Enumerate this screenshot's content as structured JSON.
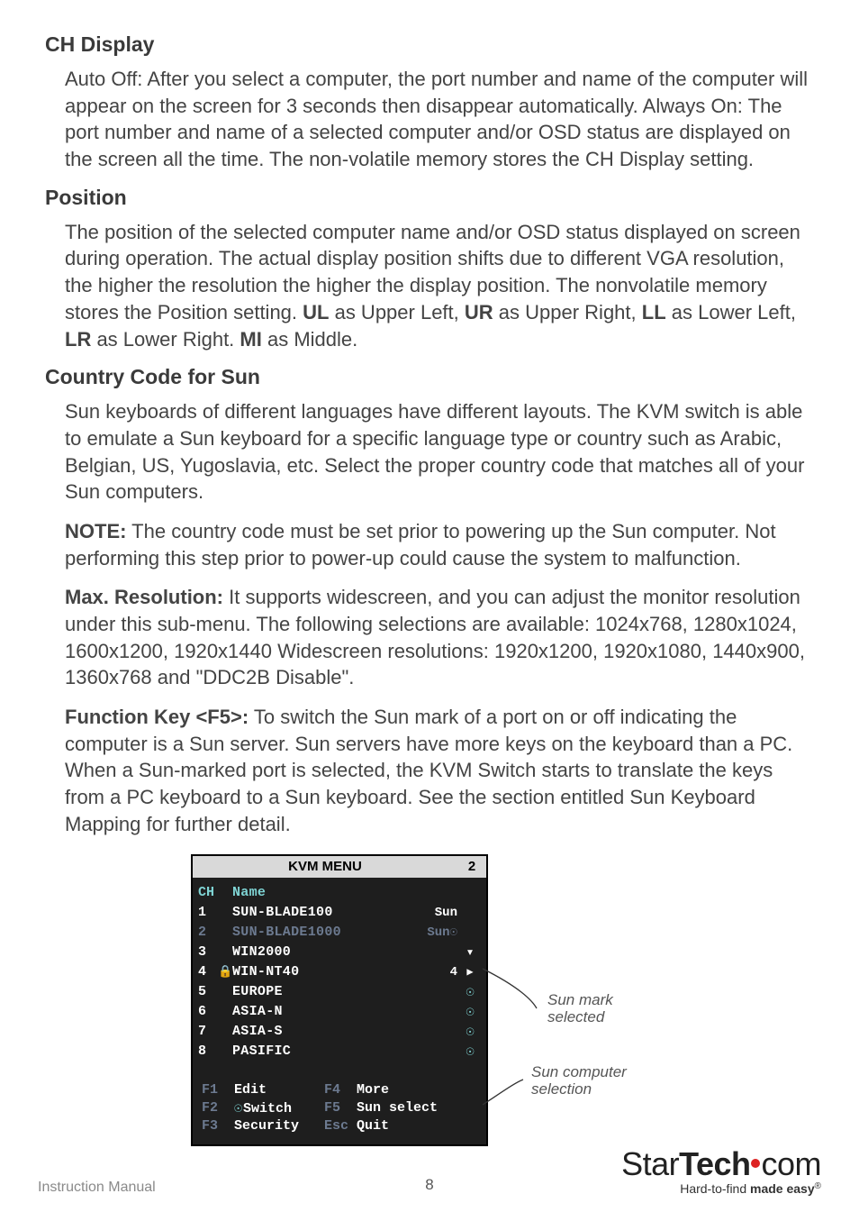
{
  "sections": {
    "ch_display": {
      "head": "CH Display",
      "body": "Auto Off: After you select a computer, the port number and name of the computer will appear on the screen for 3 seconds then disappear automatically. Always On: The port number and name of a selected computer and/or OSD status are displayed on the screen all the time. The non-volatile memory stores the CH Display setting."
    },
    "position": {
      "head": "Position",
      "body_pre": "The position of the selected computer name and/or OSD status displayed on screen during operation. The actual display position shifts due to different VGA resolution, the higher the resolution the higher the display position. The nonvolatile memory stores the Position setting.  ",
      "ul": "UL",
      "ul_txt": " as Upper Left, ",
      "ur": "UR",
      "ur_txt": " as Upper Right, ",
      "ll": "LL",
      "ll_txt": " as Lower Left, ",
      "lr": "LR",
      "lr_txt": " as Lower Right. ",
      "mi": "MI",
      "mi_txt": " as Middle."
    },
    "country": {
      "head": "Country Code for Sun",
      "body": "Sun keyboards of different languages have different layouts. The KVM switch is able to emulate a Sun keyboard for a specific language type or country such as Arabic, Belgian, US, Yugoslavia, etc. Select the proper country code that matches all of your Sun computers.",
      "note_b": "NOTE:",
      "note": " The country code must be set prior to powering up the Sun computer. Not performing this step prior to power-up could cause the system to malfunction."
    },
    "maxres": {
      "b": "Max. Resolution:",
      "body": " It supports widescreen, and you can adjust the monitor resolution under this sub-menu. The following selections are available: 1024x768, 1280x1024, 1600x1200, 1920x1440 Widescreen resolutions: 1920x1200, 1920x1080, 1440x900, 1360x768 and \"DDC2B Disable\"."
    },
    "f5": {
      "b": "Function Key <F5>:",
      "body": " To switch the Sun mark of a port on or off indicating the computer is a Sun server. Sun servers have more keys on the keyboard than a PC. When a Sun-marked port is selected, the KVM Switch starts to translate the keys from a PC keyboard to a Sun keyboard. See the section entitled Sun Keyboard Mapping for further detail."
    }
  },
  "kvm": {
    "title": "KVM MENU",
    "title_num": "2",
    "head_ch": "CH",
    "head_name": "Name",
    "rows": [
      {
        "ch": "1",
        "lock": "",
        "name": "SUN-BLADE100",
        "tag": "Sun",
        "mark": "",
        "dim": false
      },
      {
        "ch": "2",
        "lock": "",
        "name": "SUN-BLADE1000",
        "tag": "Sun☉",
        "mark": "",
        "dim": true
      },
      {
        "ch": "3",
        "lock": "",
        "name": "WIN2000",
        "tag": "",
        "mark": "▾",
        "dim": false
      },
      {
        "ch": "4",
        "lock": "🔒",
        "name": "WIN-NT40",
        "tag": "4",
        "mark": "▶",
        "dim": false
      },
      {
        "ch": "5",
        "lock": "",
        "name": "EUROPE",
        "tag": "",
        "mark": "☉",
        "dim": false
      },
      {
        "ch": "6",
        "lock": "",
        "name": "ASIA-N",
        "tag": "",
        "mark": "☉",
        "dim": false
      },
      {
        "ch": "7",
        "lock": "",
        "name": "ASIA-S",
        "tag": "",
        "mark": "☉",
        "dim": false
      },
      {
        "ch": "8",
        "lock": "",
        "name": "PASIFIC",
        "tag": "",
        "mark": "☉",
        "dim": false
      }
    ],
    "bottom": {
      "f1": "F1",
      "f1l": "Edit",
      "f2": "F2",
      "f2l": "Switch",
      "f3": "F3",
      "f3l": "Security",
      "f4": "F4",
      "f4l": "More",
      "f5": "F5",
      "f5l": "Sun select",
      "esc": "Esc",
      "escl": "Quit"
    }
  },
  "annotations": {
    "a1": "Sun mark selected",
    "a2": "Sun computer selection"
  },
  "footer": {
    "iman": "Instruction Manual",
    "page": "8",
    "brand_a": "Star",
    "brand_b": "Tech",
    "brand_c": "com",
    "tag_pre": "Hard-to-find ",
    "tag_b": "made easy",
    "tag_r": "®"
  }
}
